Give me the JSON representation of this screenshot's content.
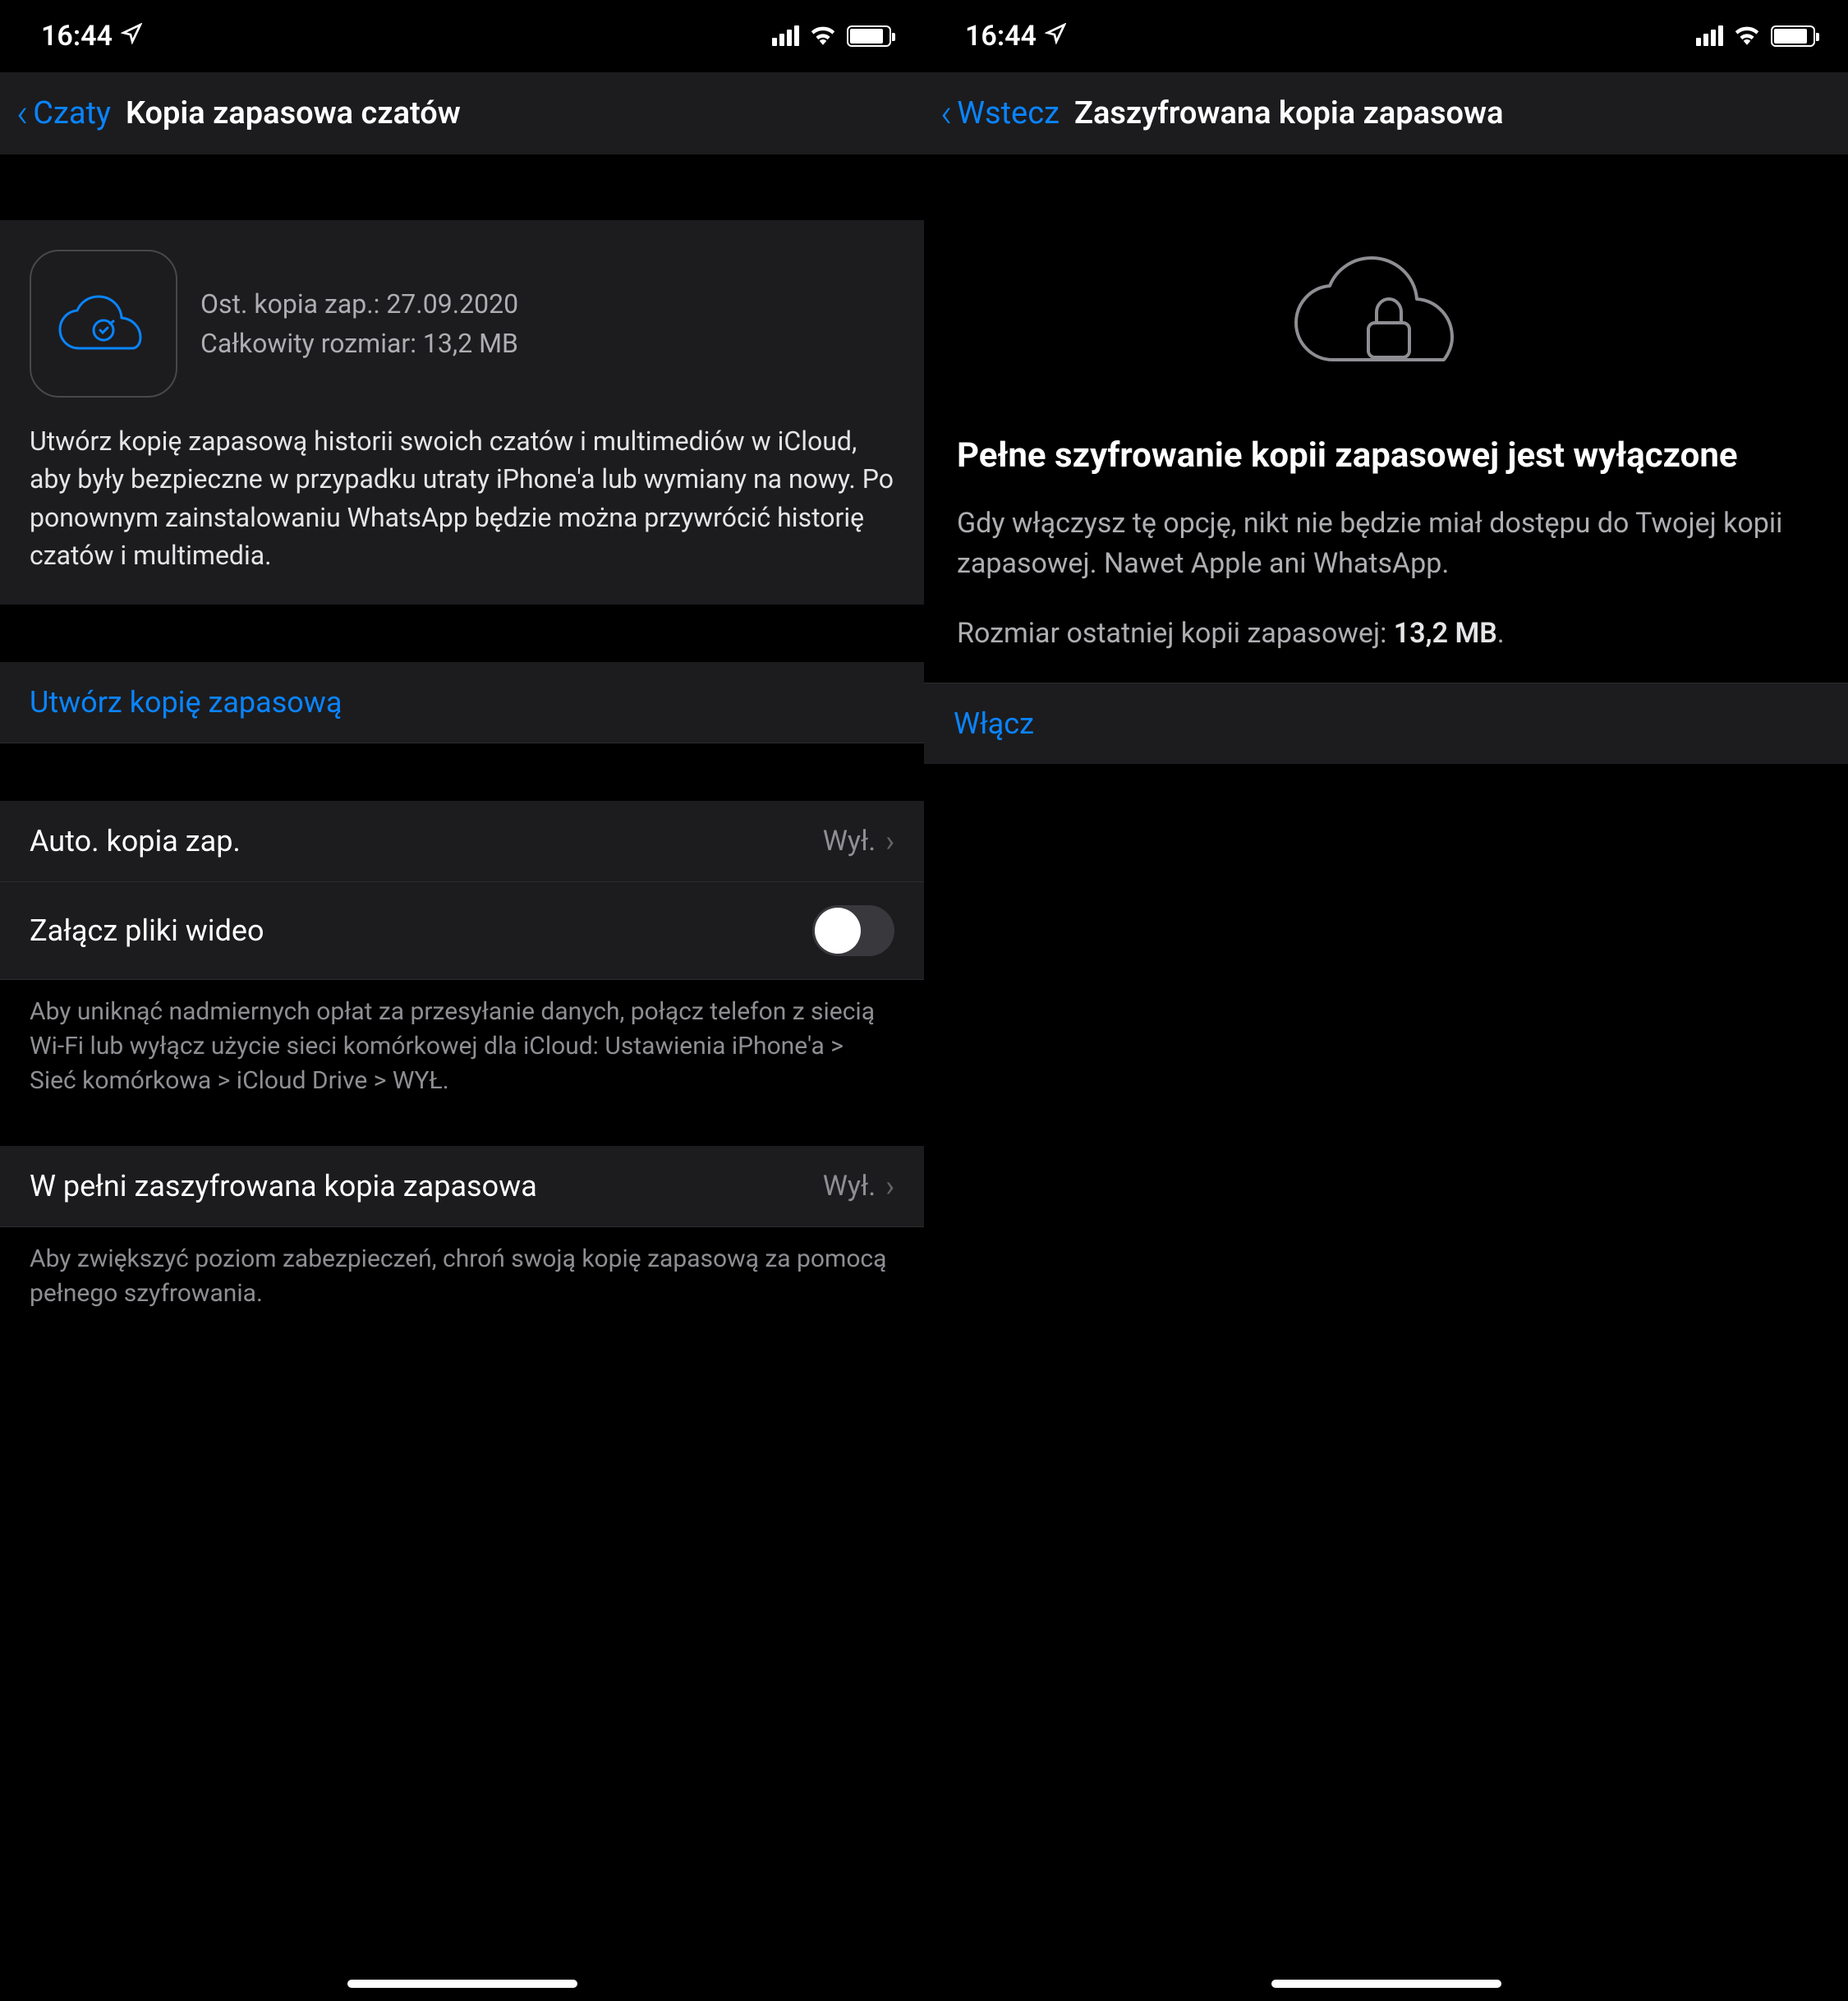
{
  "status": {
    "time": "16:44"
  },
  "left": {
    "nav": {
      "back": "Czaty",
      "title": "Kopia zapasowa czatów"
    },
    "info": {
      "last_backup_label": "Ost. kopia zap.: 27.09.2020",
      "size_label": "Całkowity rozmiar: 13,2 MB",
      "desc": "Utwórz kopię zapasową historii swoich czatów i multimediów w iCloud, aby były bezpieczne w przypadku utraty iPhone'a lub wymiany na nowy. Po ponownym zainstalowaniu WhatsApp będzie można przywrócić historię czatów i multimedia."
    },
    "actions": {
      "backup_now": "Utwórz kopię zapasową"
    },
    "auto": {
      "label": "Auto. kopia zap.",
      "value": "Wył."
    },
    "video": {
      "label": "Załącz pliki wideo",
      "enabled": false
    },
    "video_footer": "Aby uniknąć nadmiernych opłat za przesyłanie danych, połącz telefon z siecią Wi-Fi lub wyłącz użycie sieci komórkowej dla iCloud: Ustawienia iPhone'a > Sieć komórkowa > iCloud Drive > WYŁ.",
    "e2e": {
      "label": "W pełni zaszyfrowana kopia zapasowa",
      "value": "Wył."
    },
    "e2e_footer": "Aby zwiększyć poziom zabezpieczeń, chroń swoją kopię zapasową za pomocą pełnego szyfrowania."
  },
  "right": {
    "nav": {
      "back": "Wstecz",
      "title": "Zaszyfrowana kopia zapasowa"
    },
    "hero": {
      "title": "Pełne szyfrowanie kopii zapasowej jest wyłączone",
      "desc": "Gdy włączysz tę opcję, nikt nie będzie miał dostępu do Twojej kopii zapasowej. Nawet Apple ani WhatsApp.",
      "size_label": "Rozmiar ostatniej kopii zapasowej: ",
      "size_value": "13,2 MB"
    },
    "actions": {
      "enable": "Włącz"
    }
  }
}
